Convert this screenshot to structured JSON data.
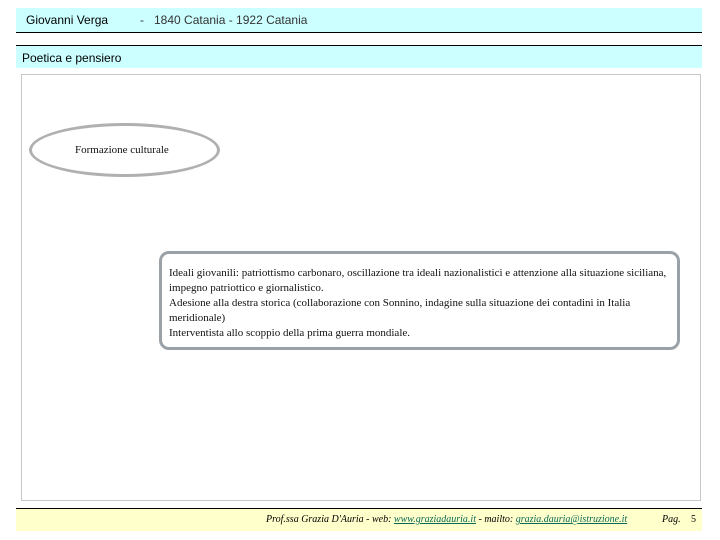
{
  "header": {
    "title": "Giovanni Verga",
    "separator": "-",
    "dates": "1840 Catania - 1922 Catania"
  },
  "section": {
    "title": "Poetica e pensiero"
  },
  "diagram": {
    "ellipse_label": "Formazione culturale",
    "lines": [
      "Ideali giovanili: patriottismo carbonaro, oscillazione tra ideali nazionalistici e attenzione alla situazione siciliana, impegno patriottico e giornalistico.",
      "Adesione alla destra storica (collaborazione con Sonnino, indagine sulla situazione dei contadini in Italia meridionale)",
      "Interventista allo scoppio della prima guerra mondiale."
    ]
  },
  "footer": {
    "author": "Prof.ssa Grazia D'Auria",
    "sep1": "-",
    "web_label": "web:",
    "web_link": "www.graziadauria.it",
    "sep2": "- mailto:",
    "mail_link": "grazia.dauria@istruzione.it",
    "page_label": "Pag.",
    "page_number": "5"
  },
  "colors": {
    "header_bg": "#ccffff",
    "footer_bg": "#ffffcc",
    "ellipse_border": "#b0b0b0",
    "box_border": "#9aa2a8",
    "link": "#0b6a55"
  }
}
